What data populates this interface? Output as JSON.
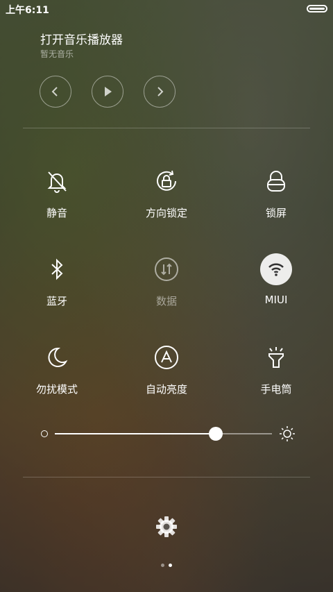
{
  "status": {
    "time": "上午6:11"
  },
  "music": {
    "title": "打开音乐播放器",
    "subtitle": "暂无音乐",
    "controls": [
      "previous-icon",
      "play-icon",
      "next-icon"
    ]
  },
  "toggles": [
    {
      "label": "静音",
      "icon": "silent-bell-icon",
      "active": false
    },
    {
      "label": "方向锁定",
      "icon": "rotation-lock-icon",
      "active": false
    },
    {
      "label": "锁屏",
      "icon": "lock-icon",
      "active": false
    },
    {
      "label": "蓝牙",
      "icon": "bluetooth-icon",
      "active": false
    },
    {
      "label": "数据",
      "icon": "mobile-data-icon",
      "active": false,
      "disabled": true
    },
    {
      "label": "MIUI",
      "icon": "wifi-icon",
      "active": true
    },
    {
      "label": "勿扰模式",
      "icon": "moon-icon",
      "active": false
    },
    {
      "label": "自动亮度",
      "icon": "auto-brightness-icon",
      "active": false
    },
    {
      "label": "手电筒",
      "icon": "flashlight-icon",
      "active": false
    }
  ],
  "brightness": {
    "level": 0.74
  },
  "pager": {
    "count": 2,
    "current": 2
  },
  "colors": {
    "active_toggle_bg": "#ffffff",
    "active_icon": "#333333"
  }
}
